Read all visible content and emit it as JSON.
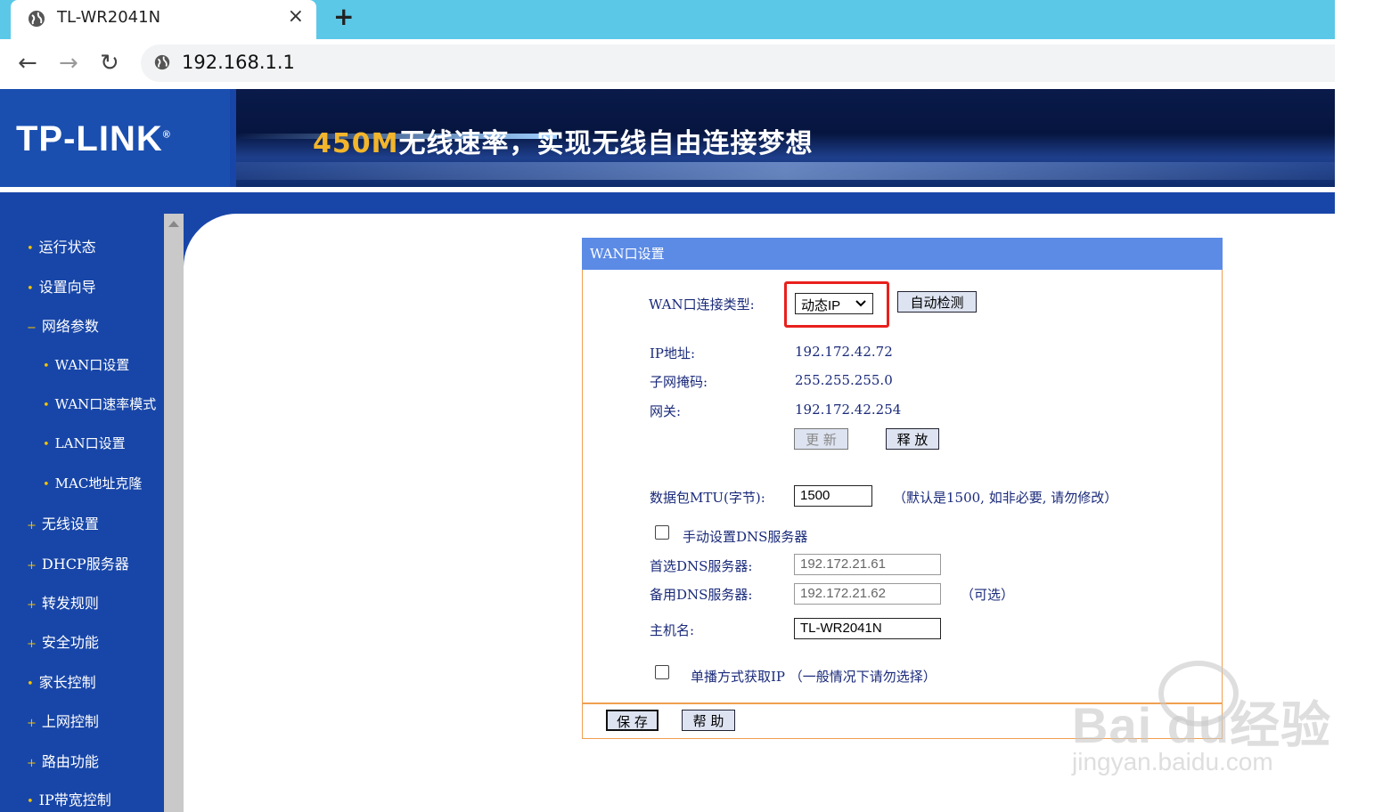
{
  "browser": {
    "tab_title": "TL-WR2041N",
    "close_glyph": "×",
    "newtab_glyph": "+",
    "back_glyph": "←",
    "forward_glyph": "→",
    "reload_glyph": "↻",
    "url": "192.168.1.1"
  },
  "header": {
    "logo": "TP-LINK",
    "logo_mark": "®",
    "slogan_highlight": "450M",
    "slogan_rest": "无线速率，实现无线自由连接梦想"
  },
  "sidebar": {
    "items": [
      {
        "marker": "•",
        "label": "运行状态"
      },
      {
        "marker": "•",
        "label": "设置向导"
      },
      {
        "marker": "−",
        "label": "网络参数"
      },
      {
        "marker": "•",
        "label": "WAN口设置"
      },
      {
        "marker": "•",
        "label": "WAN口速率模式"
      },
      {
        "marker": "•",
        "label": "LAN口设置"
      },
      {
        "marker": "•",
        "label": "MAC地址克隆"
      },
      {
        "marker": "+",
        "label": "无线设置"
      },
      {
        "marker": "+",
        "label": "DHCP服务器"
      },
      {
        "marker": "+",
        "label": "转发规则"
      },
      {
        "marker": "+",
        "label": "安全功能"
      },
      {
        "marker": "•",
        "label": "家长控制"
      },
      {
        "marker": "+",
        "label": "上网控制"
      },
      {
        "marker": "+",
        "label": "路由功能"
      },
      {
        "marker": "•",
        "label": "IP带宽控制"
      }
    ]
  },
  "panel": {
    "title": "WAN口设置",
    "conn_type_label": "WAN口连接类型:",
    "conn_type_value": "动态IP",
    "auto_detect_label": "自动检测",
    "ip_label": "IP地址:",
    "ip_value": "192.172.42.72",
    "mask_label": "子网掩码:",
    "mask_value": "255.255.255.0",
    "gateway_label": "网关:",
    "gateway_value": "192.172.42.254",
    "renew_label": "更 新",
    "release_label": "释 放",
    "mtu_label": "数据包MTU(字节):",
    "mtu_value": "1500",
    "mtu_hint": "（默认是1500, 如非必要, 请勿修改）",
    "manual_dns_label": "手动设置DNS服务器",
    "dns1_label": "首选DNS服务器:",
    "dns1_value": "192.172.21.61",
    "dns2_label": "备用DNS服务器:",
    "dns2_value": "192.172.21.62",
    "dns2_hint": "（可选）",
    "hostname_label": "主机名:",
    "hostname_value": "TL-WR2041N",
    "unicast_label": "单播方式获取IP （一般情况下请勿选择）",
    "save_label": "保 存",
    "help_label": "帮 助"
  },
  "watermark": {
    "text": "Bai du经验",
    "url": "jingyan.baidu.com"
  },
  "colors": {
    "tabbar": "#5bc8e8",
    "brand_blue": "#1846a8",
    "panel_title": "#5c8be6",
    "panel_border": "#f0a050",
    "highlight_red": "#e8201c"
  }
}
